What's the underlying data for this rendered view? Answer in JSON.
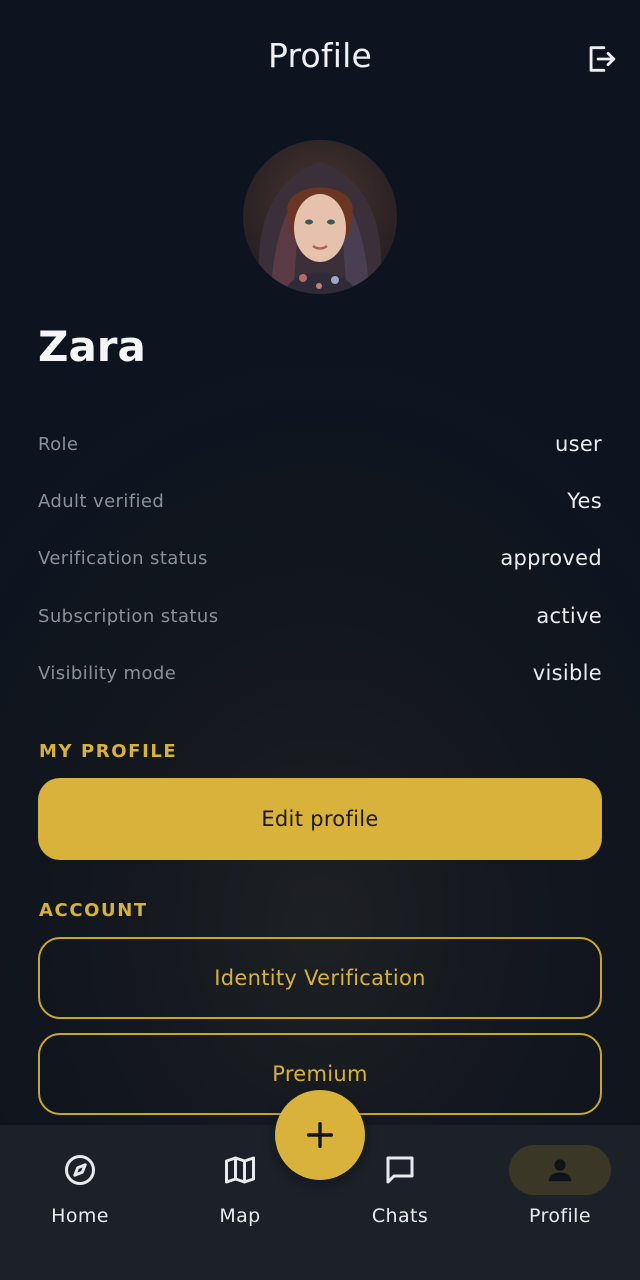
{
  "header": {
    "title": "Profile",
    "logout_icon": "logout-icon"
  },
  "profile": {
    "avatar": "user-photo",
    "name": "Zara",
    "info": [
      {
        "label": "Role",
        "value": "user"
      },
      {
        "label": "Adult verified",
        "value": "Yes"
      },
      {
        "label": "Verification status",
        "value": "approved"
      },
      {
        "label": "Subscription status",
        "value": "active"
      },
      {
        "label": "Visibility mode",
        "value": "visible"
      }
    ]
  },
  "sections": {
    "my_profile": {
      "title": "MY PROFILE",
      "edit_profile_label": "Edit profile"
    },
    "account": {
      "title": "ACCOUNT",
      "identity_verification_label": "Identity Verification",
      "premium_label": "Premium"
    }
  },
  "fab": {
    "icon": "plus-icon"
  },
  "bottom_nav": {
    "active": "Profile",
    "items": [
      {
        "label": "Home",
        "icon": "compass-icon"
      },
      {
        "label": "Map",
        "icon": "map-icon"
      },
      {
        "label": "Chats",
        "icon": "chat-icon"
      },
      {
        "label": "Profile",
        "icon": "person-icon"
      }
    ]
  },
  "colors": {
    "accent": "#d8b23a",
    "background": "#0d1420",
    "nav_background": "#1b2029"
  }
}
